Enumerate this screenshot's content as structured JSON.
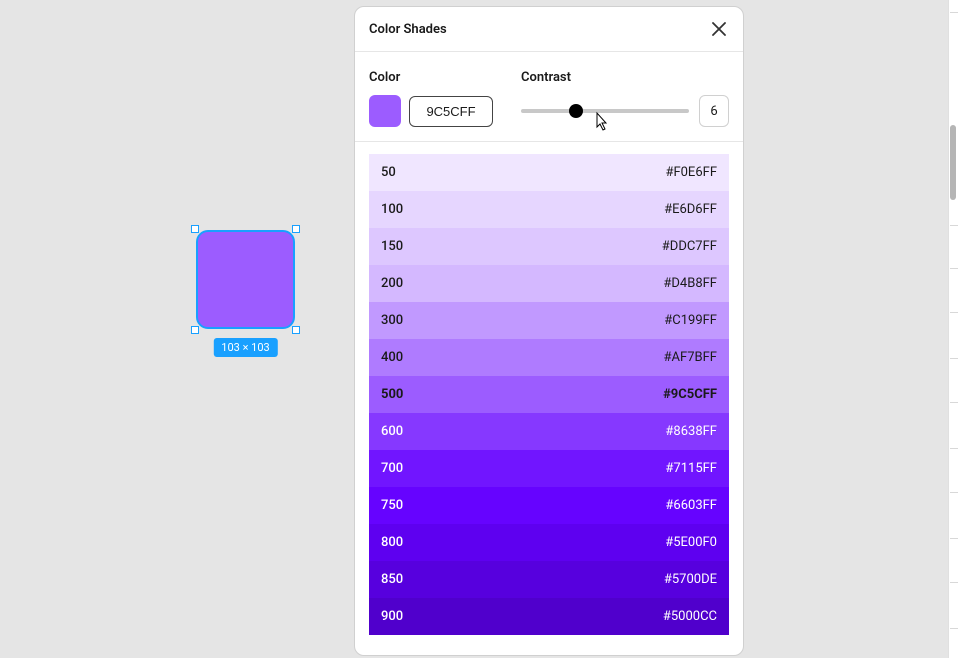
{
  "selection": {
    "dimension_label": "103 × 103",
    "fill": "#9C5CFF"
  },
  "panel": {
    "title": "Color Shades",
    "color_label": "Color",
    "contrast_label": "Contrast",
    "hex_value": "9C5CFF",
    "contrast_value": "6",
    "swatch_color": "#9C5CFF",
    "active_shade": "500",
    "shades": [
      {
        "level": "50",
        "hex": "#F0E6FF",
        "text": "#1a1a1a"
      },
      {
        "level": "100",
        "hex": "#E6D6FF",
        "text": "#1a1a1a"
      },
      {
        "level": "150",
        "hex": "#DDC7FF",
        "text": "#1a1a1a"
      },
      {
        "level": "200",
        "hex": "#D4B8FF",
        "text": "#1a1a1a"
      },
      {
        "level": "300",
        "hex": "#C199FF",
        "text": "#1a1a1a"
      },
      {
        "level": "400",
        "hex": "#AF7BFF",
        "text": "#1a1a1a"
      },
      {
        "level": "500",
        "hex": "#9C5CFF",
        "text": "#1a1a1a"
      },
      {
        "level": "600",
        "hex": "#8638FF",
        "text": "#ffffff"
      },
      {
        "level": "700",
        "hex": "#7115FF",
        "text": "#ffffff"
      },
      {
        "level": "750",
        "hex": "#6603FF",
        "text": "#ffffff"
      },
      {
        "level": "800",
        "hex": "#5E00F0",
        "text": "#ffffff"
      },
      {
        "level": "850",
        "hex": "#5700DE",
        "text": "#ffffff"
      },
      {
        "level": "900",
        "hex": "#5000CC",
        "text": "#ffffff"
      }
    ]
  }
}
